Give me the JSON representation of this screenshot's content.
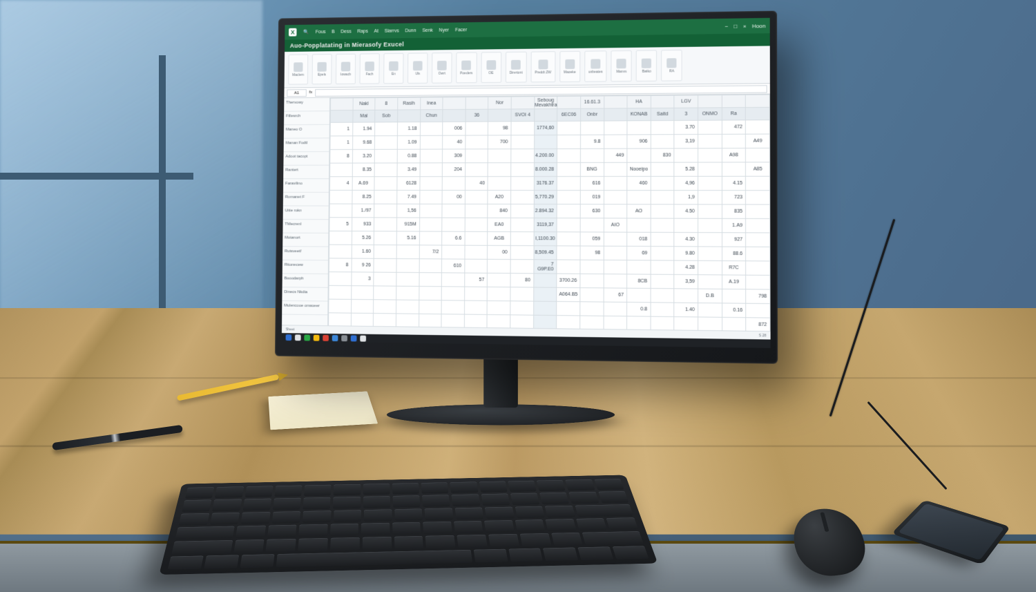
{
  "scene": {
    "description": "Rendered illustration of a desktop computer on a wooden desk showing a spreadsheet application",
    "props": [
      "sticky-note-pad",
      "yellow-pencil",
      "black-pen",
      "black-keyboard",
      "black-mouse",
      "smartphone"
    ]
  },
  "app": {
    "icon_letter": "X",
    "menus": [
      "Fous",
      "B",
      "Dess",
      "Raps",
      "At",
      "Siarrvs",
      "Dunn",
      "Senk",
      "Nyer",
      "Facer"
    ],
    "subtitle": "Auo-Popplatating in Mierasofy Exucel",
    "window_controls": [
      "−",
      "□",
      "×"
    ],
    "right_label": "Hoon"
  },
  "ribbon_groups": [
    "Maclern",
    "Epels",
    "Iowacb",
    "Fach",
    "En",
    "Uls",
    "Owrt",
    "Poeders",
    "OE",
    "Dirertont",
    "Preddt ZW",
    "Maoeke",
    "unbeates",
    "Manvs",
    "Batko",
    "RA"
  ],
  "formula": {
    "cell_ref": "A1",
    "fx": "fx"
  },
  "row_nav": [
    "Thervowy",
    "Fillesrch",
    "Maneo O",
    "Manan Fodtl",
    "Adoot tacopt",
    "Rantert",
    "Faravilino",
    "Romanet F",
    "Uitie rokn",
    "TMecrenl",
    "Motanort",
    "Rutsveetf",
    "Rttonecew",
    "Booodarph",
    "Dinecs Nkdia",
    "Mulencooe onwoeer"
  ],
  "headers1": [
    "",
    "Nakl",
    "8",
    "Rasih",
    "Inea",
    "",
    "",
    "Nor",
    "",
    "Seboug Mevakhtra",
    "",
    "16.61.3",
    "",
    "HA",
    "",
    "LGV",
    "",
    "",
    ""
  ],
  "headers2": [
    "",
    "Mal",
    "Sob",
    "",
    "Chun",
    "",
    "36",
    "",
    "SVOI 4",
    "",
    "6EC06",
    "Onbr",
    "",
    "KONAB",
    "Saitd",
    "3",
    "ONMO",
    "Ra",
    ""
  ],
  "rows": [
    [
      "1",
      "1.94",
      "",
      "1.18",
      "",
      "006",
      "",
      "98",
      "",
      "1774,60",
      "",
      "",
      "",
      "",
      "",
      "3.70",
      "",
      "472",
      ""
    ],
    [
      "1",
      "9.68",
      "",
      "1.09",
      "",
      "40",
      "",
      "700",
      "",
      "",
      "",
      "9.8",
      "",
      "906",
      "",
      "3,19",
      "",
      "",
      "A49"
    ],
    [
      "8",
      "3.20",
      "",
      "0.88",
      "",
      "309",
      "",
      "",
      "",
      "4.200.00",
      "",
      "",
      "449",
      "",
      "830",
      "",
      "",
      "A98",
      ""
    ],
    [
      "",
      "8.35",
      "",
      "3.49",
      "",
      "204",
      "",
      "",
      "",
      "8.000.28",
      "",
      "BNG",
      "",
      "Nooeipo",
      "",
      "5.28",
      "",
      "",
      "A85"
    ],
    [
      "4",
      "A.69",
      "",
      "6128",
      "",
      "",
      "40",
      "",
      "",
      "3176.37",
      "",
      "616",
      "",
      "460",
      "",
      "4,96",
      "",
      "4.15",
      ""
    ],
    [
      "",
      "8.25",
      "",
      "7.49",
      "",
      "00",
      "",
      "A20",
      "",
      "5,770.29",
      "",
      "019",
      "",
      "",
      "",
      "1,9",
      "",
      "723",
      ""
    ],
    [
      "",
      "1./97",
      "",
      "1,56",
      "",
      "",
      "",
      "840",
      "",
      "2.894.32",
      "",
      "630",
      "",
      "AO",
      "",
      "4.50",
      "",
      "835",
      ""
    ],
    [
      "5",
      "933",
      "",
      "915M",
      "",
      "",
      "",
      "EA0",
      "",
      "3119,37",
      "",
      "",
      "AIO",
      "",
      "",
      "",
      "",
      "1.A9",
      ""
    ],
    [
      "",
      "5.26",
      "",
      "5.16",
      "",
      "6.6",
      "",
      "AGB",
      "",
      "I,1100.30",
      "",
      "059",
      "",
      "018",
      "",
      "4.30",
      "",
      "927",
      ""
    ],
    [
      "",
      "1.60",
      "",
      "",
      "7/2",
      "",
      "",
      "00",
      "",
      "8,509.45",
      "",
      "98",
      "",
      "69",
      "",
      "9.80",
      "",
      "88.6",
      ""
    ],
    [
      "8",
      "9 26",
      "",
      "",
      "",
      "610",
      "",
      "",
      "",
      "7 G9P.E0",
      "",
      "",
      "",
      "",
      "",
      "4.28",
      "",
      "R7C",
      ""
    ],
    [
      "",
      "3",
      "",
      "",
      "",
      "",
      "57",
      "",
      "80",
      "",
      "3700.26",
      "",
      "",
      "8CB",
      "",
      "3,59",
      "",
      "A.19",
      ""
    ],
    [
      "",
      "",
      "",
      "",
      "",
      "",
      "",
      "",
      "",
      "",
      "A064.B5",
      "",
      "67",
      "",
      "",
      "",
      "D.B",
      "",
      "798"
    ],
    [
      "",
      "",
      "",
      "",
      "",
      "",
      "",
      "",
      "",
      "",
      "",
      "",
      "",
      "0.8",
      "",
      "1.40",
      "",
      "0.16",
      ""
    ],
    [
      "",
      "",
      "",
      "",
      "",
      "",
      "",
      "",
      "",
      "",
      "",
      "",
      "",
      "",
      "",
      "",
      "",
      "",
      "872"
    ]
  ],
  "statusbar": {
    "left": "Sheet",
    "right": "S 28"
  },
  "taskbar_colors": [
    "#2f6fd1",
    "#e0e3e6",
    "#29a745",
    "#f2b90e",
    "#d94134",
    "#3c87d8",
    "#888e94",
    "#2f6fd1",
    "#e0e3e6"
  ]
}
